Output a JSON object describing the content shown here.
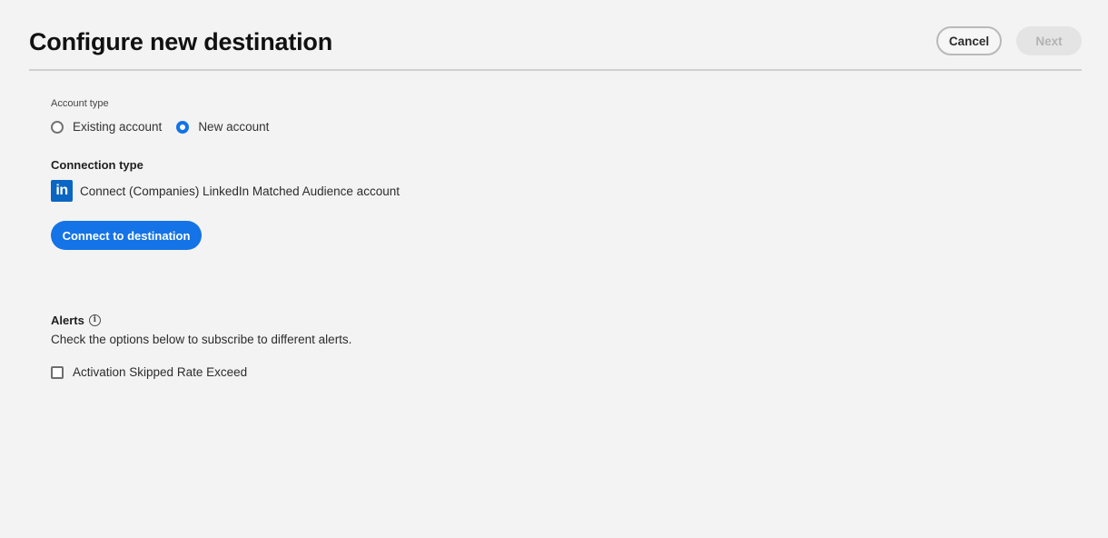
{
  "header": {
    "title": "Configure new destination",
    "cancel_label": "Cancel",
    "next_label": "Next"
  },
  "account_type": {
    "label": "Account type",
    "options": [
      {
        "label": "Existing account",
        "selected": false
      },
      {
        "label": "New account",
        "selected": true
      }
    ]
  },
  "connection": {
    "heading": "Connection type",
    "logo_icon": "linkedin-logo-icon",
    "logo_text": "in",
    "logo_color": "#0a66c2",
    "text": "Connect (Companies) LinkedIn Matched Audience account",
    "connect_label": "Connect to destination",
    "connect_color": "#1473e6"
  },
  "alerts": {
    "title": "Alerts",
    "info_icon": "info-icon",
    "description": "Check the options below to subscribe to different alerts.",
    "options": [
      {
        "label": "Activation Skipped Rate Exceed",
        "checked": false
      }
    ]
  }
}
